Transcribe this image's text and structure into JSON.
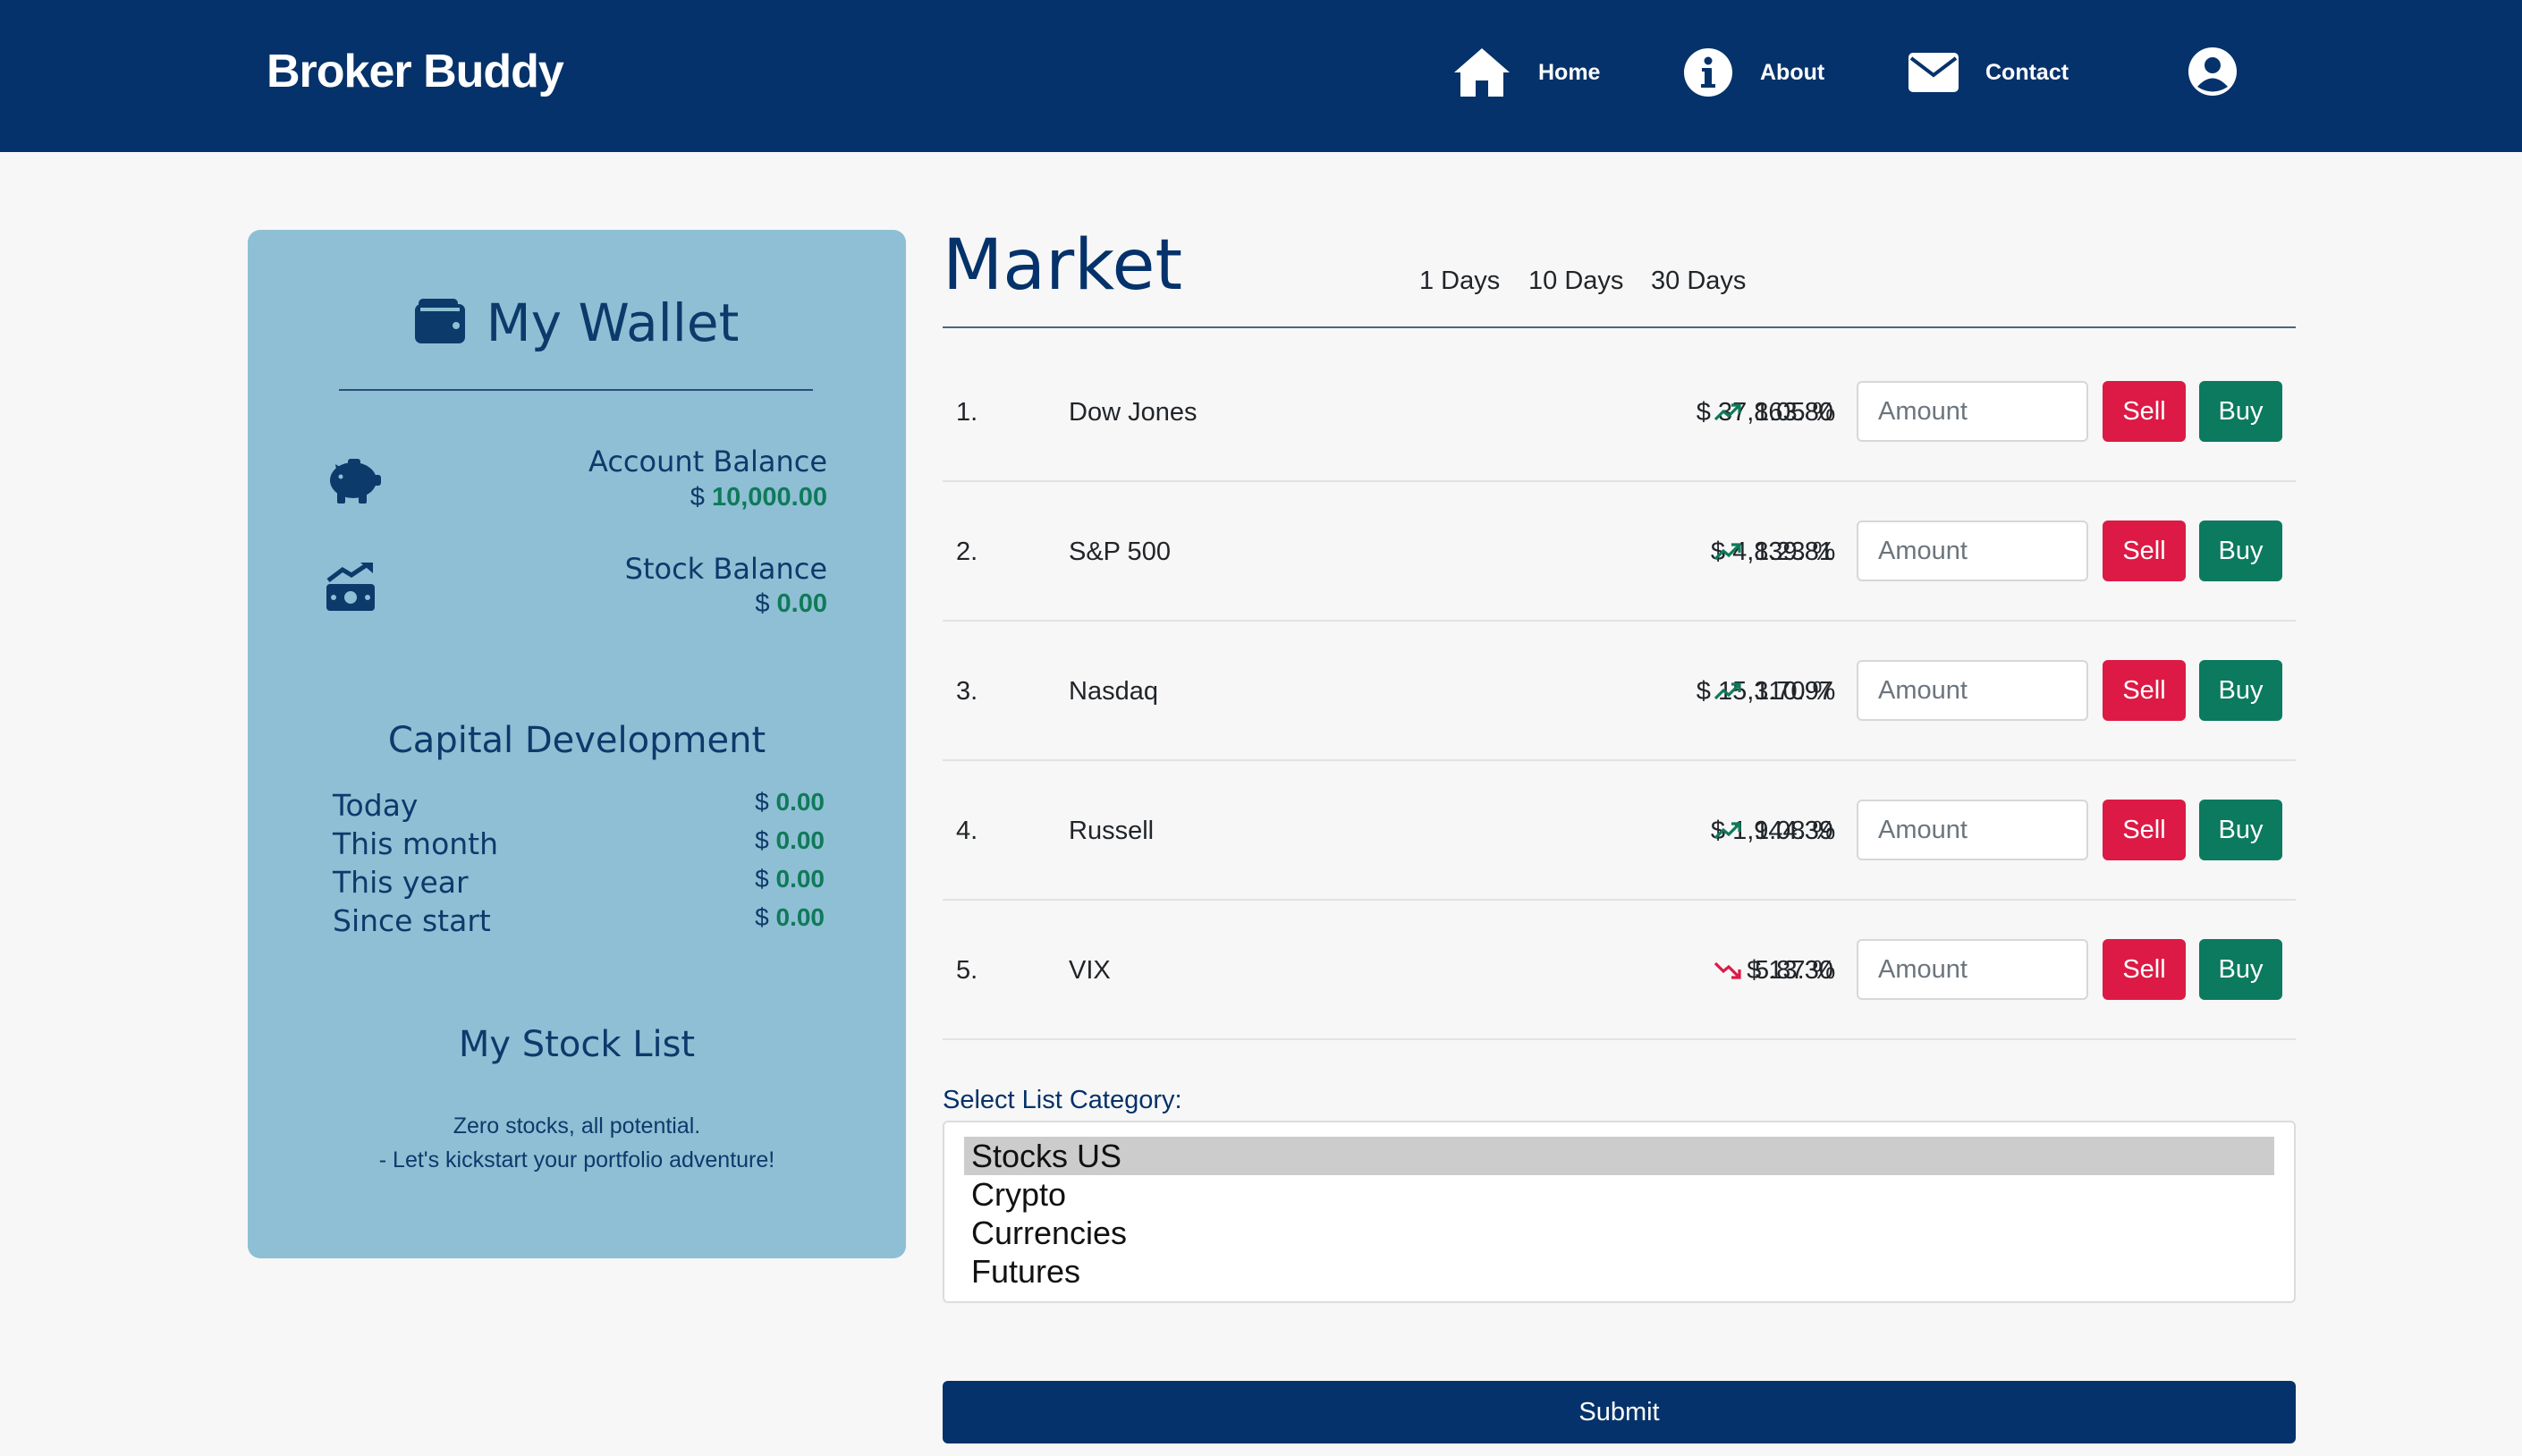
{
  "header": {
    "brand": "Broker Buddy",
    "nav": [
      {
        "label": "Home",
        "icon": "home-icon"
      },
      {
        "label": "About",
        "icon": "info-icon"
      },
      {
        "label": "Contact",
        "icon": "envelope-icon"
      }
    ],
    "user_icon": "user-circle-icon"
  },
  "wallet": {
    "title": "My Wallet",
    "account_balance_label": "Account Balance",
    "account_balance_currency": "$",
    "account_balance_value": "10,000.00",
    "stock_balance_label": "Stock Balance",
    "stock_balance_currency": "$",
    "stock_balance_value": "0.00",
    "capital_title": "Capital Development",
    "capital_rows": [
      {
        "label": "Today",
        "currency": "$",
        "value": "0.00"
      },
      {
        "label": "This month",
        "currency": "$",
        "value": "0.00"
      },
      {
        "label": "This year",
        "currency": "$",
        "value": "0.00"
      },
      {
        "label": "Since start",
        "currency": "$",
        "value": "0.00"
      }
    ],
    "stock_list_title": "My Stock List",
    "stock_list_msg_1": "Zero stocks, all potential.",
    "stock_list_msg_2": "- Let's kickstart your portfolio adventure!"
  },
  "market": {
    "title": "Market",
    "ranges": [
      "1 Days",
      "10 Days",
      "30 Days"
    ],
    "rows": [
      {
        "index": "1.",
        "name": "Dow Jones",
        "price": "$ 37,863.80",
        "trend": "up",
        "change": "1.05 %",
        "amount_placeholder": "Amount",
        "sell": "Sell",
        "buy": "Buy"
      },
      {
        "index": "2.",
        "name": "S&P 500",
        "price": "$ 4,839.81",
        "trend": "up",
        "change": "1.23 %",
        "amount_placeholder": "Amount",
        "sell": "Sell",
        "buy": "Buy"
      },
      {
        "index": "3.",
        "name": "Nasdaq",
        "price": "$ 15,310.97",
        "trend": "up",
        "change": "1.70 %",
        "amount_placeholder": "Amount",
        "sell": "Sell",
        "buy": "Buy"
      },
      {
        "index": "4.",
        "name": "Russell",
        "price": "$ 1,944.39",
        "trend": "up",
        "change": "1.08 %",
        "amount_placeholder": "Amount",
        "sell": "Sell",
        "buy": "Buy"
      },
      {
        "index": "5.",
        "name": "VIX",
        "price": "$ 13.30",
        "trend": "down",
        "change": "5.87 %",
        "amount_placeholder": "Amount",
        "sell": "Sell",
        "buy": "Buy"
      }
    ],
    "select_label": "Select List Category:",
    "categories": [
      "Stocks US",
      "Crypto",
      "Currencies",
      "Futures"
    ],
    "selected_category": "Stocks US",
    "submit": "Submit"
  },
  "colors": {
    "navy": "#05326a",
    "wallet_bg": "#8fbfd4",
    "green": "#0b7a5e",
    "red": "#dc1a45",
    "trend_up": "#0f7a5a",
    "trend_down": "#dc1a45"
  }
}
